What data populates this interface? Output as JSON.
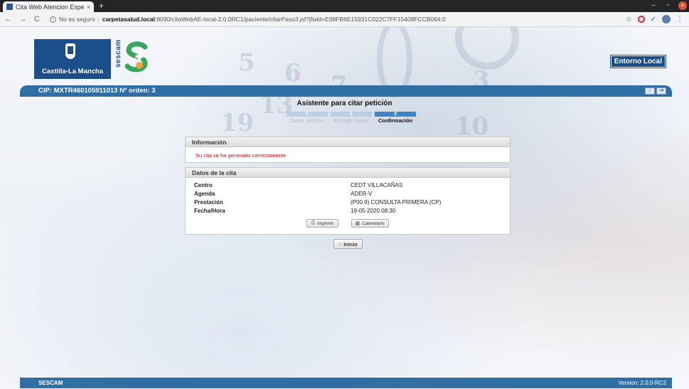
{
  "browser": {
    "tab_title": "Cita Web Atencion Espec",
    "tab_close": "×",
    "new_tab": "+",
    "win_min": "–",
    "win_max": "▫",
    "win_close": "×",
    "nav_back": "←",
    "nav_forward": "→",
    "nav_reload": "C",
    "url_security": "No es seguro",
    "url_host": "carpetasalud.local",
    "url_path": ":8090/citaWebAE-local-2.0.0RC1/paciente/citarPaso3.jsf?jfwid=E98FB6E15931C022C7FF15408FCCB064:0",
    "star": "☆",
    "menu": "⋮"
  },
  "header": {
    "region_logo_text": "Castilla-La Mancha",
    "service_logo_text": "sescam",
    "environment_label": "Entorno Local"
  },
  "patient_bar": {
    "text": "CIP: MXTR460105911013   Nº orden: 3",
    "icon1": "⌂",
    "icon2": "⇥"
  },
  "wizard": {
    "title": "Asistente para citar petición",
    "steps": [
      {
        "number": "1",
        "label": "Datos petición"
      },
      {
        "number": "2",
        "label": "Escoger hueco"
      },
      {
        "number": "3",
        "label": "Confirmación"
      }
    ]
  },
  "info_panel": {
    "title": "Información",
    "message": "Su cita se ha generado correctamente"
  },
  "appointment_panel": {
    "title": "Datos de la cita",
    "rows": [
      {
        "label": "Centro",
        "value": "CEDT VILLACAÑAS"
      },
      {
        "label": "Agenda",
        "value": "ADER-V"
      },
      {
        "label": "Prestación",
        "value": "(P00.9) CONSULTA PRIMERA (CP)"
      },
      {
        "label": "Fecha/Hora",
        "value": "19-05-2020 08:30"
      }
    ],
    "print_label": "Imprimir",
    "calendar_label": "Calendario"
  },
  "home_label": "Inicio",
  "footer": {
    "left": "SESCAM",
    "right": "Version: 2.0.0-RC2"
  },
  "colors": {
    "primary_blue": "#2f6fa6",
    "logo_blue": "#1b4f8c",
    "success_red": "#cc1111",
    "step_active": "#3b86c4"
  }
}
